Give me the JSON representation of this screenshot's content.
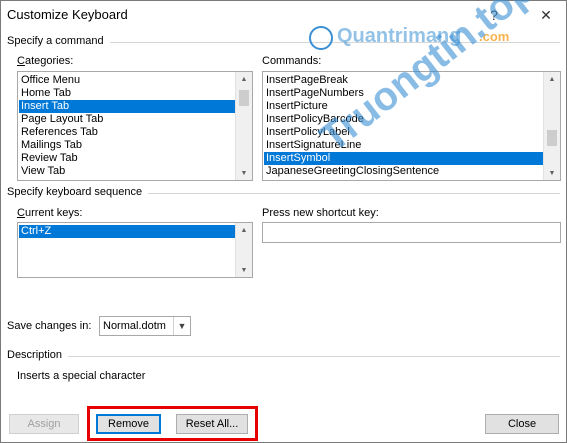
{
  "dialog": {
    "title": "Customize Keyboard",
    "help_symbol": "?",
    "close_symbol": "✕"
  },
  "command_section": {
    "label": "Specify a command",
    "categories_label": "Categories:",
    "commands_label": "Commands:",
    "categories": [
      {
        "label": "Office Menu",
        "selected": false
      },
      {
        "label": "Home Tab",
        "selected": false
      },
      {
        "label": "Insert Tab",
        "selected": true
      },
      {
        "label": "Page Layout Tab",
        "selected": false
      },
      {
        "label": "References Tab",
        "selected": false
      },
      {
        "label": "Mailings Tab",
        "selected": false
      },
      {
        "label": "Review Tab",
        "selected": false
      },
      {
        "label": "View Tab",
        "selected": false
      }
    ],
    "commands": [
      {
        "label": "InsertPageBreak",
        "selected": false
      },
      {
        "label": "InsertPageNumbers",
        "selected": false
      },
      {
        "label": "InsertPicture",
        "selected": false
      },
      {
        "label": "InsertPolicyBarcode",
        "selected": false
      },
      {
        "label": "InsertPolicyLabel",
        "selected": false
      },
      {
        "label": "InsertSignatureLine",
        "selected": false
      },
      {
        "label": "InsertSymbol",
        "selected": true
      },
      {
        "label": "JapaneseGreetingClosingSentence",
        "selected": false
      }
    ]
  },
  "keyboard_section": {
    "label": "Specify keyboard sequence",
    "current_keys_label": "Current keys:",
    "current_keys": [
      {
        "label": "Ctrl+Z",
        "selected": true
      }
    ],
    "new_shortcut_label": "Press new shortcut key:",
    "new_shortcut_value": ""
  },
  "save": {
    "label": "Save changes in:",
    "value": "Normal.dotm"
  },
  "description": {
    "label": "Description",
    "text": "Inserts a special character"
  },
  "buttons": {
    "assign": "Assign",
    "remove": "Remove",
    "reset_all": "Reset All...",
    "close": "Close"
  },
  "watermark": {
    "top": "Quantrimang",
    "domain": ".com",
    "side": "Truongtin.top"
  },
  "colors": {
    "selection": "#0078d7",
    "highlight_box": "#e60000",
    "watermark_blue": "#3b8fd4",
    "watermark_orange": "#f39200"
  }
}
